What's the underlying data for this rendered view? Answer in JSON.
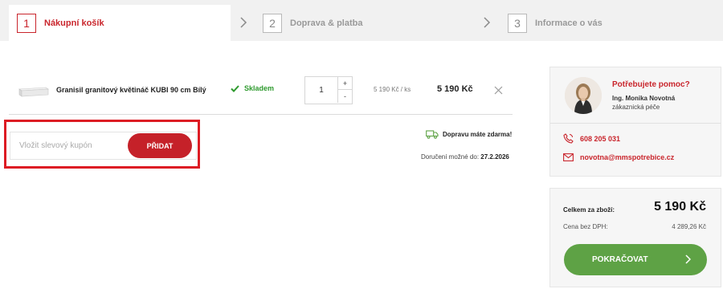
{
  "steps": [
    {
      "number": "1",
      "label": "Nákupní košík",
      "active": true
    },
    {
      "number": "2",
      "label": "Doprava & platba",
      "active": false
    },
    {
      "number": "3",
      "label": "Informace o vás",
      "active": false
    }
  ],
  "cart": {
    "items": [
      {
        "name": "Granisil granitový květináč KUBI 90 cm Bílý",
        "stock_status": "Skladem",
        "quantity": "1",
        "qty_up": "+",
        "qty_down": "-",
        "unit_price": "5 190 Kč / ks",
        "total_price": "5 190 Kč"
      }
    ]
  },
  "coupon": {
    "placeholder": "Vložit slevový kupón",
    "button_label": "PŘIDAT"
  },
  "shipping": {
    "free_shipping_text": "Dopravu máte zdarma!",
    "delivery_label": "Doručení možné do:",
    "delivery_date": "27.2.2026"
  },
  "help": {
    "title": "Potřebujete pomoc?",
    "name": "Ing. Monika Novotná",
    "role": "zákaznická péče",
    "phone": "608 205 031",
    "email": "novotna@mmspotrebice.cz"
  },
  "summary": {
    "total_label": "Celkem za zboží:",
    "total_value": "5 190 Kč",
    "vat_label": "Cena bez DPH:",
    "vat_value": "4 289,26 Kč",
    "continue_label": "POKRAČOVAT"
  },
  "colors": {
    "brand_red": "#c9252c",
    "stock_green": "#2e9a2e",
    "continue_green": "#5ea245",
    "highlight_outline": "#dd1c24"
  },
  "icons": {
    "stock": "check-icon",
    "remove": "close-icon",
    "shipping": "truck-icon",
    "phone": "phone-icon",
    "email": "envelope-icon",
    "continue": "chevron-right-icon",
    "step_separator": "chevron-right-icon"
  }
}
